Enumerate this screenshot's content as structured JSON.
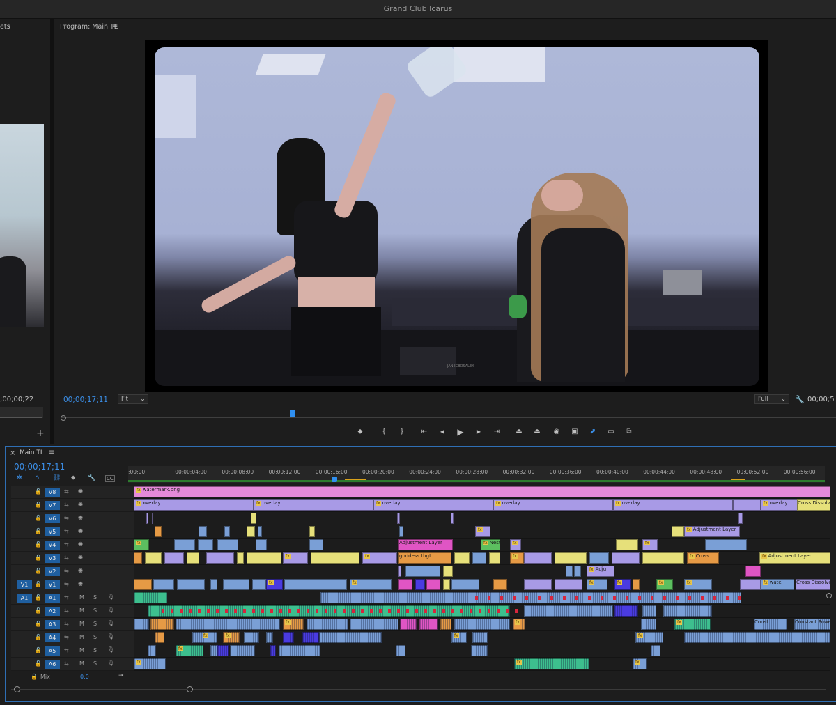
{
  "window": {
    "title": "Grand Club Icarus"
  },
  "source_panel": {
    "tab_partial": "ets",
    "timecode": ";00;00;22",
    "add_label": "+"
  },
  "program": {
    "title": "Program: Main TL",
    "menu_icon": "hamburger-icon",
    "timecode": "00;00;17;11",
    "fit": "Fit",
    "quality": "Full",
    "duration_partial": "00;00;5",
    "watermark_text": "JANECBOSALEX"
  },
  "transport": [
    {
      "name": "add-marker-button",
      "glyph": "⬥"
    },
    {
      "name": "mark-in-button",
      "glyph": "{"
    },
    {
      "name": "mark-out-button",
      "glyph": "}"
    },
    {
      "name": "go-to-in-button",
      "glyph": "⇤"
    },
    {
      "name": "step-back-button",
      "glyph": "◀"
    },
    {
      "name": "play-button",
      "glyph": "▶"
    },
    {
      "name": "step-forward-button",
      "glyph": "▶"
    },
    {
      "name": "go-to-out-button",
      "glyph": "⇥"
    },
    {
      "name": "lift-button",
      "glyph": "⏏"
    },
    {
      "name": "extract-button",
      "glyph": "⏏"
    },
    {
      "name": "export-frame-button",
      "glyph": "◉"
    },
    {
      "name": "comparison-view-button",
      "glyph": "▣"
    },
    {
      "name": "share-button",
      "glyph": "⬈"
    },
    {
      "name": "safe-margins-button",
      "glyph": "▭"
    },
    {
      "name": "vr-button",
      "glyph": "⧉"
    }
  ],
  "timeline": {
    "close": "×",
    "tab": "Main TL",
    "menu_icon": "hamburger-icon",
    "timecode": "00;00;17;11",
    "ticks": [
      ";00;00",
      "00;00;04;00",
      "00;00;08;00",
      "00;00;12;00",
      "00;00;16;00",
      "00;00;20;00",
      "00;00;24;00",
      "00;00;28;00",
      "00;00;32;00",
      "00;00;36;00",
      "00;00;40;00",
      "00;00;44;00",
      "00;00;48;00",
      "00;00;52;00",
      "00;00;56;00"
    ],
    "video_tracks": [
      {
        "id": "V8",
        "src": "",
        "lock": "🔒"
      },
      {
        "id": "V7",
        "src": ""
      },
      {
        "id": "V6",
        "src": ""
      },
      {
        "id": "V5",
        "src": ""
      },
      {
        "id": "V4",
        "src": ""
      },
      {
        "id": "V3",
        "src": ""
      },
      {
        "id": "V2",
        "src": ""
      },
      {
        "id": "V1",
        "src": "V1"
      }
    ],
    "audio_tracks": [
      {
        "id": "A1",
        "src": "A1",
        "m": "M",
        "s": "S"
      },
      {
        "id": "A2",
        "src": "",
        "m": "M",
        "s": "S"
      },
      {
        "id": "A3",
        "src": "",
        "m": "M",
        "s": "S"
      },
      {
        "id": "A4",
        "src": "",
        "m": "M",
        "s": "S"
      },
      {
        "id": "A5",
        "src": "",
        "m": "M",
        "s": "S"
      },
      {
        "id": "A6",
        "src": "",
        "m": "M",
        "s": "S"
      }
    ],
    "mix": {
      "label": "Mix",
      "value": "0.0"
    },
    "clip_labels": {
      "watermark": "watermark.png",
      "overlay": "overlay",
      "cross_dissolve": "Cross Dissolve",
      "adjustment": "Adjustment Layer",
      "nest": "Nest",
      "goddess": "goddess thgt",
      "adju": "Adju",
      "water": "wate",
      "cross_short": "Cross",
      "const": "Const",
      "constant_power": "Constant Powe",
      "fx": "fx"
    },
    "colors": {
      "pink": "#e58ad9",
      "lavender": "#a89ae6",
      "yellow": "#e6e07a",
      "blue": "#7a9fd6",
      "orange": "#e69a45",
      "green": "#5cbf5f",
      "teal": "#3dbf8e",
      "magenta": "#e055c4",
      "violet": "#4a3be0",
      "accent": "#2f6fb5"
    }
  }
}
